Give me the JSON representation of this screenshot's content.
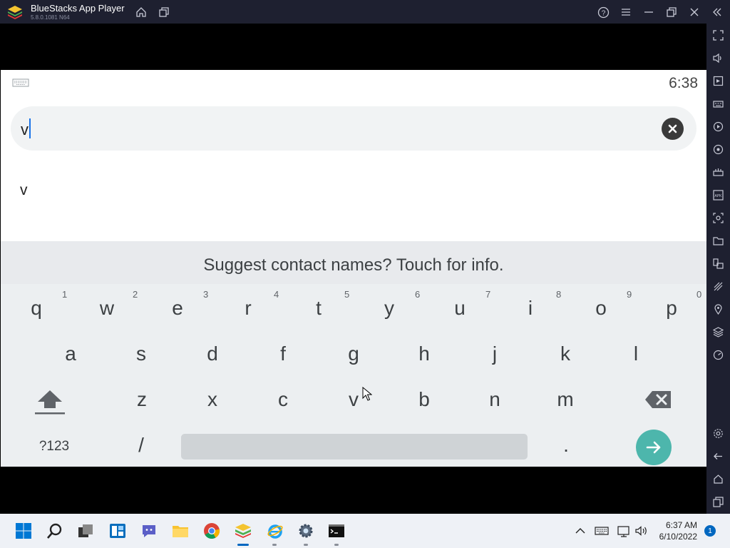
{
  "titlebar": {
    "title": "BlueStacks App Player",
    "version": "5.8.0.1081 N64"
  },
  "android": {
    "clock": "6:38",
    "search_value": "v",
    "suggestion": "v",
    "keyboard": {
      "suggest_strip": "Suggest contact names? Touch for info.",
      "row1": [
        "q",
        "w",
        "e",
        "r",
        "t",
        "y",
        "u",
        "i",
        "o",
        "p"
      ],
      "row1_hints": [
        "1",
        "2",
        "3",
        "4",
        "5",
        "6",
        "7",
        "8",
        "9",
        "0"
      ],
      "row2": [
        "a",
        "s",
        "d",
        "f",
        "g",
        "h",
        "j",
        "k",
        "l"
      ],
      "row3": [
        "z",
        "x",
        "c",
        "v",
        "b",
        "n",
        "m"
      ],
      "symbols_key": "?123",
      "slash_key": "/",
      "period_key": "."
    }
  },
  "taskbar": {
    "time": "6:37 AM",
    "date": "6/10/2022",
    "notification_count": "1"
  },
  "colors": {
    "chrome_dark": "#1e2030",
    "enter_key": "#4db6ac",
    "caret": "#1a73e8",
    "taskbar": "#eef1f6"
  }
}
